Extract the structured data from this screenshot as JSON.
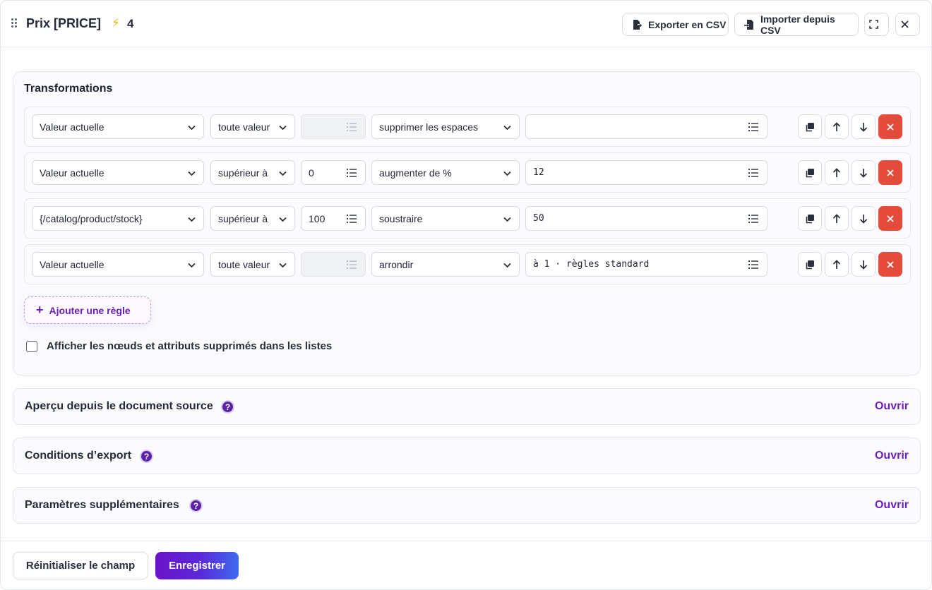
{
  "header": {
    "title": "Prix [PRICE]",
    "bolt_icon": "lightning-icon",
    "bolt_count": "4",
    "export_label": "Exporter en CSV",
    "import_label": "Importer depuis CSV"
  },
  "transformations": {
    "title": "Transformations",
    "rules": [
      {
        "source": "Valeur actuelle",
        "condition": "toute valeur",
        "number": "",
        "number_disabled": true,
        "action": "supprimer les espaces",
        "value": ""
      },
      {
        "source": "Valeur actuelle",
        "condition": "supérieur à",
        "number": "0",
        "number_disabled": false,
        "action": "augmenter de %",
        "value": "12"
      },
      {
        "source": "{/catalog/product/stock}",
        "condition": "supérieur à",
        "number": "100",
        "number_disabled": false,
        "action": "soustraire",
        "value": "50"
      },
      {
        "source": "Valeur actuelle",
        "condition": "toute valeur",
        "number": "",
        "number_disabled": true,
        "action": "arrondir",
        "value": "à 1 · règles standard"
      }
    ],
    "add_rule_label": "Ajouter une règle",
    "show_deleted_label": "Afficher les nœuds et attributs supprimés dans les listes"
  },
  "sections": [
    {
      "title": "Aperçu depuis le document source",
      "open_label": "Ouvrir"
    },
    {
      "title": "Conditions d’export",
      "open_label": "Ouvrir"
    },
    {
      "title": "Paramètres supplémentaires",
      "open_label": "Ouvrir"
    }
  ],
  "footer": {
    "reset_label": "Réinitialiser le champ",
    "save_label": "Enregistrer"
  },
  "colors": {
    "accent": "#6b1fb8",
    "danger": "#e54b3b",
    "bolt": "#f4b400"
  }
}
